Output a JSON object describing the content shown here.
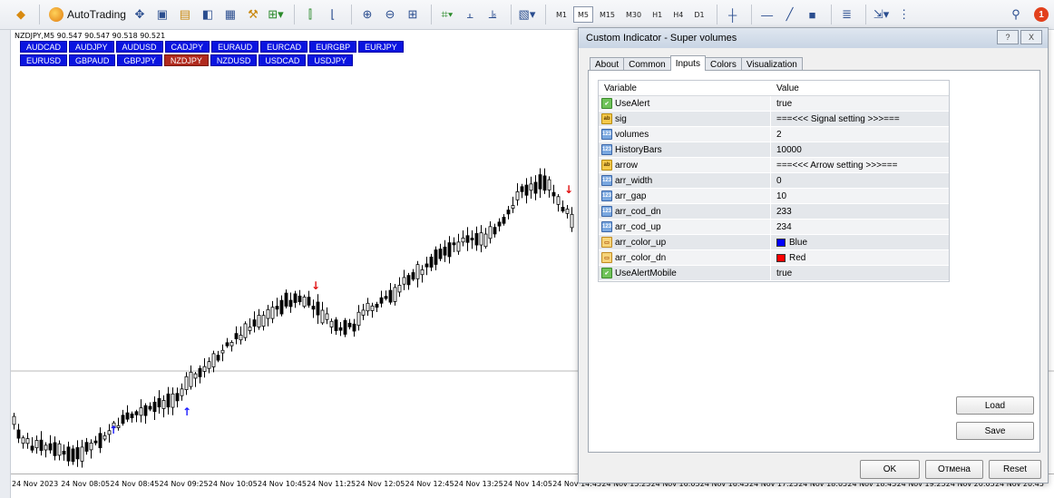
{
  "toolbar": {
    "autotrading_label": "AutoTrading",
    "timeframes": [
      "M1",
      "M5",
      "M15",
      "M30",
      "H1",
      "H4",
      "D1"
    ],
    "active_timeframe": "M5",
    "notification_count": "1"
  },
  "chart": {
    "info": "NZDJPY,M5  90.547 90.547 90.518 90.521",
    "symbol_rows": [
      [
        "AUDCAD",
        "AUDJPY",
        "AUDUSD",
        "CADJPY",
        "EURAUD",
        "EURCAD",
        "EURGBP",
        "EURJPY"
      ],
      [
        "EURUSD",
        "GBPAUD",
        "GBPJPY",
        "NZDJPY",
        "NZDUSD",
        "USDCAD",
        "USDJPY"
      ]
    ],
    "active_symbol": "NZDJPY",
    "time_labels": [
      "24 Nov 2023",
      "24 Nov 08:05",
      "24 Nov 08:45",
      "24 Nov 09:25",
      "24 Nov 10:05",
      "24 Nov 10:45",
      "24 Nov 11:25",
      "24 Nov 12:05",
      "24 Nov 12:45",
      "24 Nov 13:25",
      "24 Nov 14:05",
      "24 Nov 14:45",
      "24 Nov 15:25",
      "24 Nov 16:05",
      "24 Nov 16:45",
      "24 Nov 17:25",
      "24 Nov 18:05",
      "24 Nov 18:45",
      "24 Nov 19:25",
      "24 Nov 20:05",
      "24 Nov 20:45"
    ],
    "arrow_up_color": "#1a1aff",
    "arrow_dn_color": "#e01010"
  },
  "dialog": {
    "title": "Custom Indicator - Super volumes",
    "help_label": "?",
    "close_label": "X",
    "tabs": [
      "About",
      "Common",
      "Inputs",
      "Colors",
      "Visualization"
    ],
    "active_tab": "Inputs",
    "table_headers": [
      "Variable",
      "Value"
    ],
    "inputs": [
      {
        "type": "bool",
        "icon": "bool-icon",
        "badge": "✔",
        "name": "UseAlert",
        "value": "true"
      },
      {
        "type": "str",
        "icon": "string-icon",
        "badge": "ab",
        "name": "sig",
        "value": "===<<< Signal setting >>>==="
      },
      {
        "type": "int",
        "icon": "int-icon",
        "badge": "123",
        "name": "volumes",
        "value": "2"
      },
      {
        "type": "int",
        "icon": "int-icon",
        "badge": "123",
        "name": "HistoryBars",
        "value": "10000"
      },
      {
        "type": "str",
        "icon": "string-icon",
        "badge": "ab",
        "name": "arrow",
        "value": "===<<< Arrow setting >>>==="
      },
      {
        "type": "int",
        "icon": "int-icon",
        "badge": "123",
        "name": "arr_width",
        "value": "0"
      },
      {
        "type": "int",
        "icon": "int-icon",
        "badge": "123",
        "name": "arr_gap",
        "value": "10"
      },
      {
        "type": "int",
        "icon": "int-icon",
        "badge": "123",
        "name": "arr_cod_dn",
        "value": "233"
      },
      {
        "type": "int",
        "icon": "int-icon",
        "badge": "123",
        "name": "arr_cod_up",
        "value": "234"
      },
      {
        "type": "col",
        "icon": "color-icon",
        "badge": "▭",
        "name": "arr_color_up",
        "value": "Blue",
        "swatch": "#0000ff"
      },
      {
        "type": "col",
        "icon": "color-icon",
        "badge": "▭",
        "name": "arr_color_dn",
        "value": "Red",
        "swatch": "#ff0000"
      },
      {
        "type": "bool",
        "icon": "bool-icon",
        "badge": "✔",
        "name": "UseAlertMobile",
        "value": "true"
      }
    ],
    "load_label": "Load",
    "save_label": "Save",
    "ok_label": "OK",
    "cancel_label": "Отмена",
    "reset_label": "Reset"
  }
}
